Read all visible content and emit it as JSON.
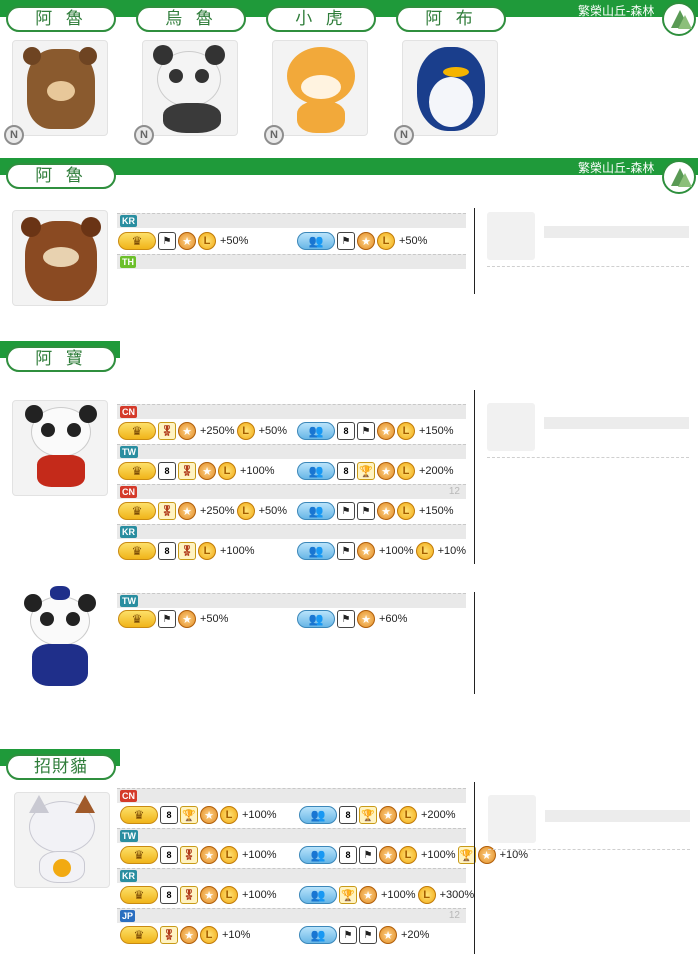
{
  "location": "繁榮山丘-森林",
  "top_tabs": [
    "阿 魯",
    "烏 魯",
    "小 虎",
    "阿 布"
  ],
  "badge": "N",
  "sections": [
    {
      "title": "阿 魯"
    },
    {
      "title": "阿 寶"
    },
    {
      "title": "招財貓"
    }
  ],
  "regions": {
    "KR": "KR",
    "TH": "TH",
    "CN": "CN",
    "TW": "TW",
    "JP": "JP"
  },
  "round_numbers": [
    "12",
    "12"
  ],
  "rules": {
    "alu_kr_solo": "+50%",
    "alu_kr_team": "+50%",
    "abao1_cn_solo_a": "+250%",
    "abao1_cn_solo_b": "+50%",
    "abao1_cn_team": "+150%",
    "abao1_tw_solo": "+100%",
    "abao1_tw_team": "+200%",
    "abao1_cn2_solo_a": "+250%",
    "abao1_cn2_solo_b": "+50%",
    "abao1_cn2_team": "+150%",
    "abao1_kr_solo": "+100%",
    "abao1_kr_team_a": "+100%",
    "abao1_kr_team_b": "+10%",
    "abao2_tw_solo": "+50%",
    "abao2_tw_team": "+60%",
    "cat_cn_solo": "+100%",
    "cat_cn_team": "+200%",
    "cat_tw_solo": "+100%",
    "cat_tw_team_a": "+100%",
    "cat_tw_team_b": "+10%",
    "cat_kr_solo": "+100%",
    "cat_kr_team_a": "+100%",
    "cat_kr_team_b": "+300%",
    "cat_jp_solo": "+10%",
    "cat_jp_team": "+20%"
  },
  "icon_glyphs": {
    "coin": "L",
    "star": "★",
    "flag": "⚑",
    "medal": "🎖",
    "cup": "🏆",
    "n8": "8",
    "solo": "♛",
    "team": "👥"
  },
  "colors": {
    "green": "#1f9a3a",
    "region_red": "#d43a2a",
    "region_teal": "#2a8ea0",
    "region_blue": "#2a6ec0",
    "region_lime": "#6cbf2a"
  }
}
